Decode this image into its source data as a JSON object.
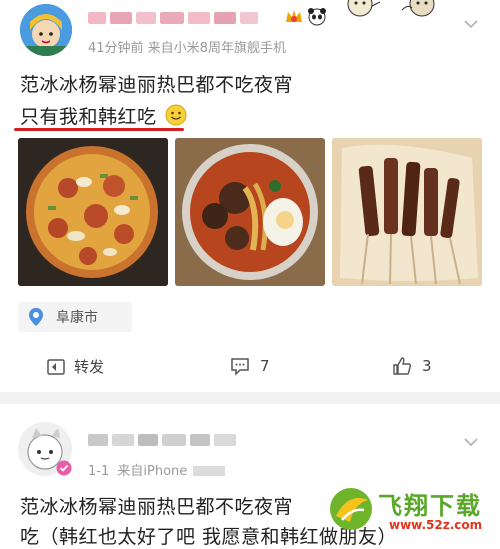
{
  "post1": {
    "meta": "41分钟前 来自小米8周年旗舰手机",
    "text_line1": "范冰冰杨幂迪丽热巴都不吃夜宵",
    "text_line2": "只有我和韩红吃",
    "location": "阜康市",
    "actions": {
      "repost": "转发",
      "comments": "7",
      "likes": "3"
    }
  },
  "post2": {
    "meta_time": "1-1",
    "meta_source": "来自iPhone",
    "text_line1": "范冰冰杨幂迪丽热巴都不吃夜宵",
    "text_line2": "吃（韩红也太好了吧 我愿意和韩红做朋友）"
  },
  "watermark": {
    "brand": "飞翔下载",
    "url": "www.52z.com"
  }
}
